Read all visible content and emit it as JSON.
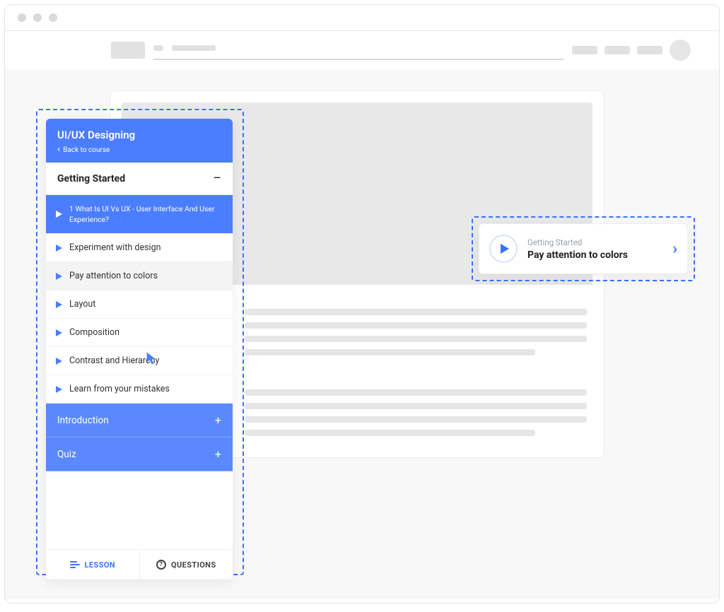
{
  "sidebar": {
    "title": "UI/UX Designing",
    "back_label": "Back to course",
    "section1_title": "Getting Started",
    "section1_toggle": "–",
    "items": [
      {
        "label": "1 What Is UI Vs UX - User Interface And User Experience?"
      },
      {
        "label": "Experiment with design"
      },
      {
        "label": "Pay attention to colors"
      },
      {
        "label": "Layout"
      },
      {
        "label": "Composition"
      },
      {
        "label": "Contrast and Hierarchy"
      },
      {
        "label": "Learn from your mistakes"
      }
    ],
    "section2_title": "Introduction",
    "section2_toggle": "+",
    "section3_title": "Quiz",
    "section3_toggle": "+",
    "tab_lesson": "LESSON",
    "tab_questions": "QUESTIONS"
  },
  "tooltip": {
    "category": "Getting Started",
    "title": "Pay attention to colors"
  },
  "colors": {
    "primary": "#4b7dff",
    "dashed": "#3a72ff"
  }
}
